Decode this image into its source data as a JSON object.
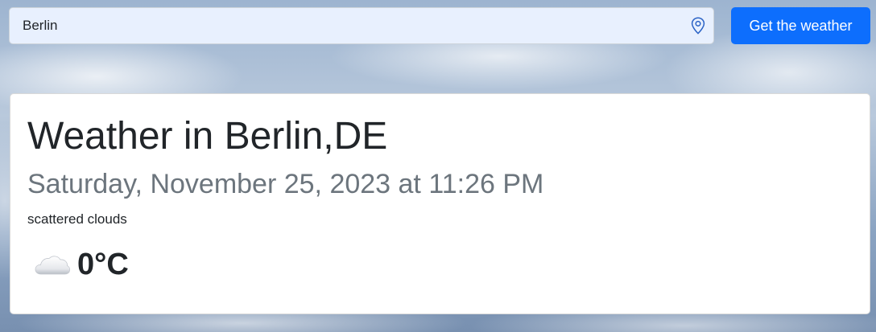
{
  "search": {
    "value": "Berlin",
    "button_label": "Get the weather"
  },
  "weather": {
    "title": "Weather in Berlin,DE",
    "datetime": "Saturday, November 25, 2023 at 11:26 PM",
    "description": "scattered clouds",
    "condition_icon": "cloud-icon",
    "temperature": "0°C"
  },
  "colors": {
    "accent": "#0d6efd",
    "input_background": "#e8f0fe",
    "subtitle_text": "#6c757d"
  }
}
